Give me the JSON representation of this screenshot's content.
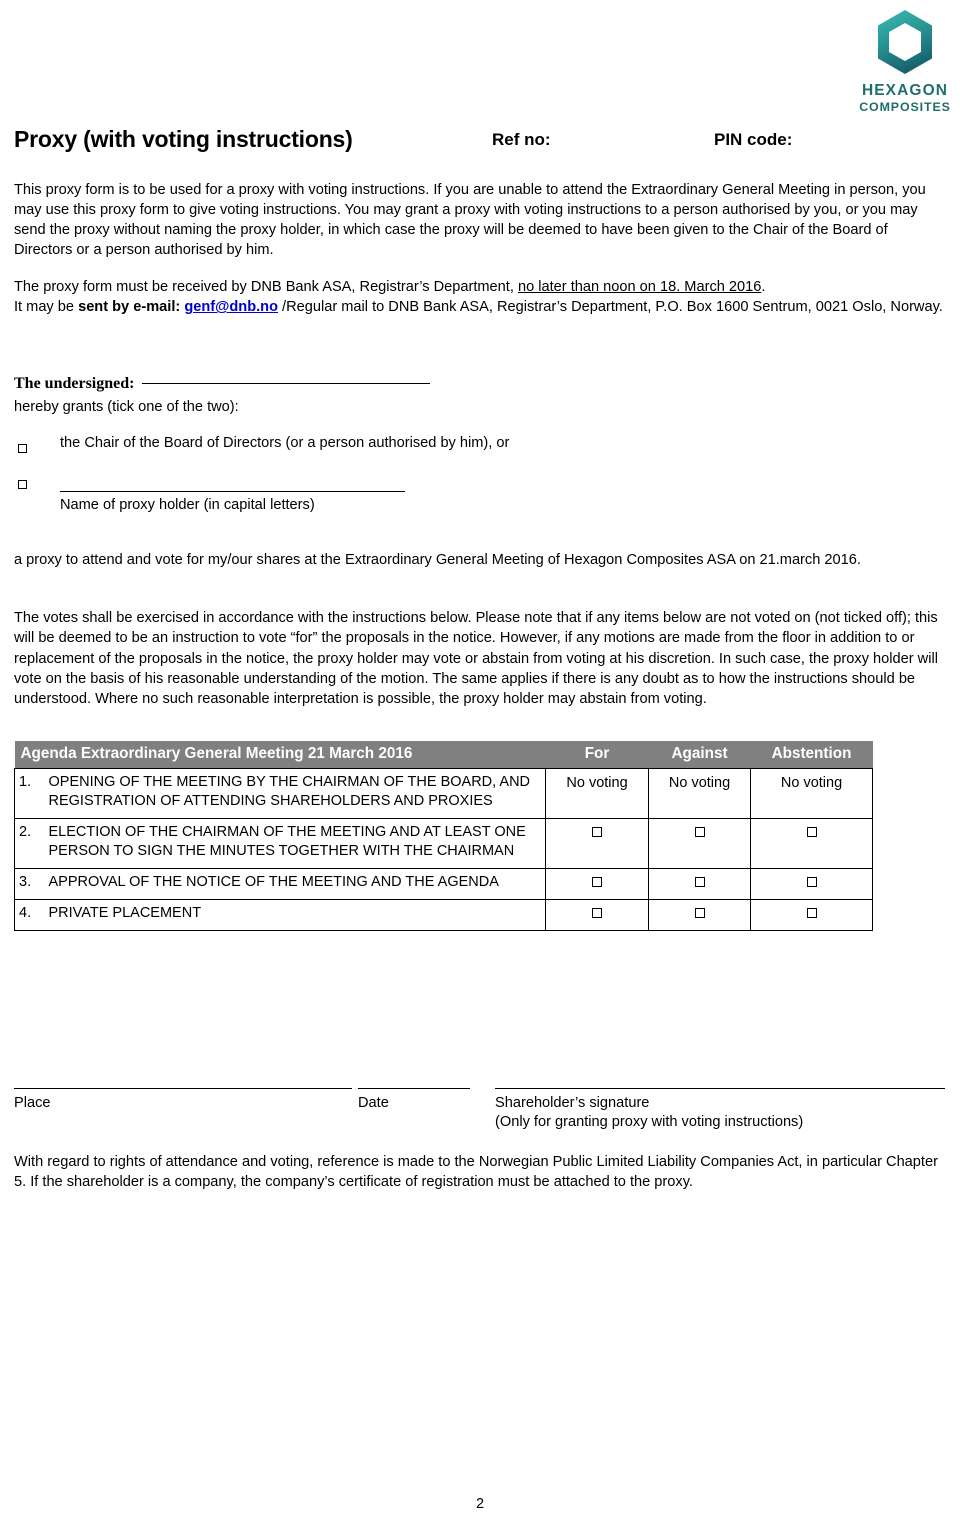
{
  "logo": {
    "icon": "hexagon-icon",
    "line1": "HEXAGON",
    "line2": "COMPOSITES",
    "color_light": "#31b0ac",
    "color_dark": "#1a6b72",
    "text_color": "#1f6f6b"
  },
  "header": {
    "title": "Proxy (with voting instructions)",
    "ref_no_label": "Ref no:",
    "pin_code_label": "PIN code:"
  },
  "intro": {
    "paragraph": "This proxy form is to be used for a proxy with voting instructions. If you are unable to attend the Extraordinary General Meeting in person, you may use this proxy form to give voting instructions. You may grant a proxy with voting instructions to a person authorised by you, or you may send the proxy without naming the proxy holder, in which case the proxy will be deemed to have been given to the Chair of the Board of Directors or a person authorised by him."
  },
  "deadline": {
    "text_before": "The proxy form must be received by DNB Bank ASA, Registrar’s Department, ",
    "underlined": "no later than noon on 18. March 2016",
    "text_after_period": ".",
    "second_line_before": "It may be ",
    "bold_label": "sent by e-mail: ",
    "email": "genf@dnb.no",
    "second_line_after": " /Regular mail to DNB Bank ASA, Registrar’s Department, P.O. Box 1600 Sentrum, 0021 Oslo, Norway."
  },
  "undersigned": {
    "label": "The undersigned:",
    "grants_text": "hereby grants (tick one of the two):",
    "option1_label": "the Chair of the Board of Directors  (or a person authorised by him), or",
    "option2_caption": "Name of proxy holder (in capital letters)"
  },
  "proxy_purpose": {
    "text": "a proxy to attend and vote for my/our shares at the Extraordinary General Meeting of Hexagon Composites ASA on 21.march 2016."
  },
  "votes_note": {
    "text": "The votes shall be exercised in accordance with the instructions below. Please note that if any items below are not voted on (not ticked off); this will be deemed to be an instruction to vote “for” the proposals in the notice. However, if any motions are made from the floor in addition to or replacement of the proposals in the notice, the proxy holder may vote or abstain from voting at his discretion. In such case, the proxy holder will vote on the basis of his reasonable understanding of the motion. The same applies if there is any doubt as to how the instructions should be understood.  Where no such reasonable interpretation is possible, the proxy holder may abstain from voting."
  },
  "agenda_table": {
    "header_bg": "#808080",
    "header_text_color": "#ffffff",
    "columns": {
      "agenda": "Agenda Extraordinary General Meeting 21 March 2016",
      "for": "For",
      "against": "Against",
      "abstention": "Abstention"
    },
    "rows": [
      {
        "number": "1.",
        "description": "OPENING OF THE MEETING BY THE CHAIRMAN OF THE BOARD, AND REGISTRATION OF ATTENDING SHAREHOLDERS AND PROXIES",
        "for": "No voting",
        "against": "No voting",
        "abstention": "No voting",
        "type": "text"
      },
      {
        "number": "2.",
        "description": "ELECTION OF THE CHAIRMAN OF THE MEETING AND AT LEAST ONE PERSON TO SIGN THE MINUTES TOGETHER WITH THE CHAIRMAN",
        "for": "",
        "against": "",
        "abstention": "",
        "type": "checkbox"
      },
      {
        "number": "3.",
        "description": "APPROVAL OF THE NOTICE OF THE MEETING AND THE AGENDA",
        "for": "",
        "against": "",
        "abstention": "",
        "type": "checkbox"
      },
      {
        "number": "4.",
        "description": "PRIVATE PLACEMENT",
        "for": "",
        "against": "",
        "abstention": "",
        "type": "checkbox"
      }
    ]
  },
  "signature": {
    "place_label": "Place",
    "date_label": "Date",
    "signature_label": "Shareholder’s signature",
    "signature_sub": "(Only for granting proxy with voting instructions)"
  },
  "footer": {
    "note": "With regard to rights of attendance and voting, reference is made to the Norwegian Public Limited Liability Companies Act, in particular Chapter 5. If the shareholder is a company, the company’s certificate of registration must be attached to the proxy.",
    "page_number": "2"
  }
}
